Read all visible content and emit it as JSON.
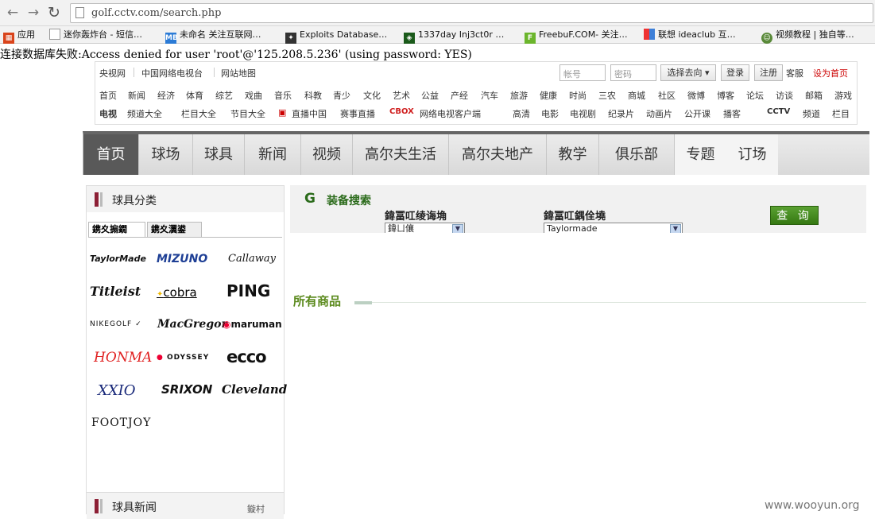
{
  "browser": {
    "url": "golf.cctv.com/search.php",
    "bookmarks": [
      {
        "label": "应用",
        "icon": "apps-grid-icon",
        "color": "#d9441c"
      },
      {
        "label": "迷你轰炸台 - 短信…",
        "icon": "page-icon",
        "color": "#888888"
      },
      {
        "label": "未命名 关注互联网…",
        "icon": "mb-icon",
        "color": "#2b7bd6"
      },
      {
        "label": "Exploits Database…",
        "icon": "exploitdb-icon",
        "color": "#333333"
      },
      {
        "label": "1337day Inj3ct0r …",
        "icon": "1337day-icon",
        "color": "#1a5a1a"
      },
      {
        "label": "FreebuF.COM- 关注…",
        "icon": "freebuf-icon",
        "color": "#6bb52c"
      },
      {
        "label": "联想 ideaclub 互…",
        "icon": "lenovo-icon",
        "color": "#3d7fd8"
      },
      {
        "label": "视频教程 | 独自等…",
        "icon": "avatar-icon",
        "color": "#5a8a3a"
      }
    ]
  },
  "error_message": "连接数据库失败:Access denied for user 'root'@'125.208.5.236' (using password: YES)",
  "cctv": {
    "top_links": [
      "央视网",
      "中国网络电视台",
      "网站地图"
    ],
    "account_placeholder": "帐号",
    "password_placeholder": "密码",
    "select_label": "选择去向",
    "login": "登录",
    "register": "注册",
    "service": "客服",
    "set_home": "设为首页",
    "channels": [
      "首页",
      "新闻",
      "经济",
      "体育",
      "综艺",
      "戏曲",
      "音乐",
      "科教",
      "青少",
      "文化",
      "艺术",
      "公益",
      "产经",
      "汽车",
      "旅游",
      "健康",
      "时尚",
      "三农",
      "商城",
      "社区",
      "微博",
      "博客",
      "论坛",
      "访谈",
      "邮箱",
      "游戏"
    ],
    "tv_label": "电视",
    "tv_links": [
      "频道大全",
      "栏目大全",
      "节目大全",
      "直播中国",
      "赛事直播",
      "网络电视客户端",
      "高清",
      "电影",
      "电视剧",
      "纪录片",
      "动画片",
      "公开课",
      "播客",
      "CCTV",
      "频道",
      "栏目"
    ],
    "cbox_logo": "CBOX"
  },
  "main_nav": [
    "首页",
    "球场",
    "球具",
    "新闻",
    "视频",
    "高尔夫生活",
    "高尔夫地产",
    "教学",
    "俱乐部",
    "专题",
    "订场"
  ],
  "left_panel": {
    "title": "球具分类",
    "tabs": [
      "鎸夊搧鐗",
      "鎸夊瀷鍙"
    ],
    "brands": [
      "TaylorMade",
      "MIZUNO",
      "Callaway",
      "Titleist",
      "cobra",
      "PING",
      "NIKEGOLF",
      "MacGregor",
      "maruman",
      "HONMA",
      "ODYSSEY",
      "ecco",
      "XXIO",
      "SRIXON",
      "Cleveland",
      "FOOTJOY"
    ],
    "news_title": "球具新闻",
    "news_more": "鏇村"
  },
  "search": {
    "title": "装备搜索",
    "field1_label": "鍏冨叿绫诲埆",
    "field1_value": "鍏ㄩ儴",
    "field2_label": "鍏冨叿鍝佺墝",
    "field2_value": "Taylormade",
    "query_button": "查 询"
  },
  "all_goods": "所有商品",
  "watermark": "www.wooyun.org"
}
